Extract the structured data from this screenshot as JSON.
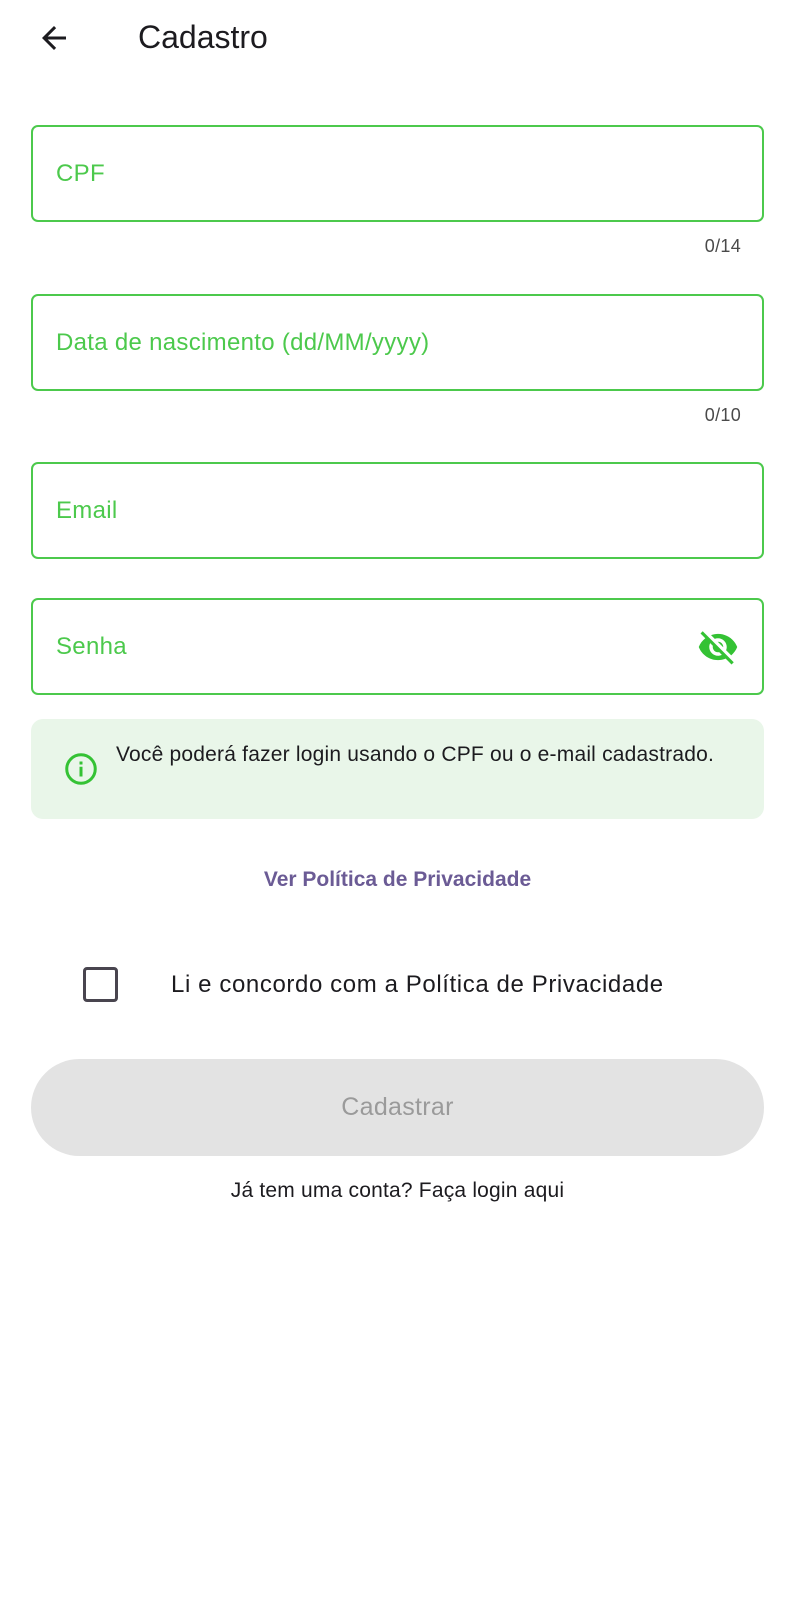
{
  "app_bar": {
    "back_icon": "arrow-back-icon",
    "title": "Cadastro"
  },
  "form": {
    "cpf": {
      "placeholder": "CPF",
      "value": "",
      "counter": "0/14"
    },
    "birth_date": {
      "placeholder": "Data de nascimento (dd/MM/yyyy)",
      "value": "",
      "counter": "0/10"
    },
    "email": {
      "placeholder": "Email",
      "value": ""
    },
    "password": {
      "placeholder": "Senha",
      "value": "",
      "visibility_icon": "visibility-off-icon"
    }
  },
  "info": {
    "icon": "info-icon",
    "text": "Você poderá fazer login usando o CPF ou o e-mail cadastrado."
  },
  "privacy_link": "Ver Política de Privacidade",
  "agree": {
    "checked": false,
    "label": "Li e concordo com a Política de Privacidade"
  },
  "submit_label": "Cadastrar",
  "login_link": "Já tem uma conta? Faça login aqui",
  "colors": {
    "accent_green": "#4cc94c",
    "info_bg": "#e9f6e9",
    "link_purple": "#6b5b95",
    "disabled_bg": "#e3e3e3",
    "disabled_text": "#9a9a9a"
  }
}
